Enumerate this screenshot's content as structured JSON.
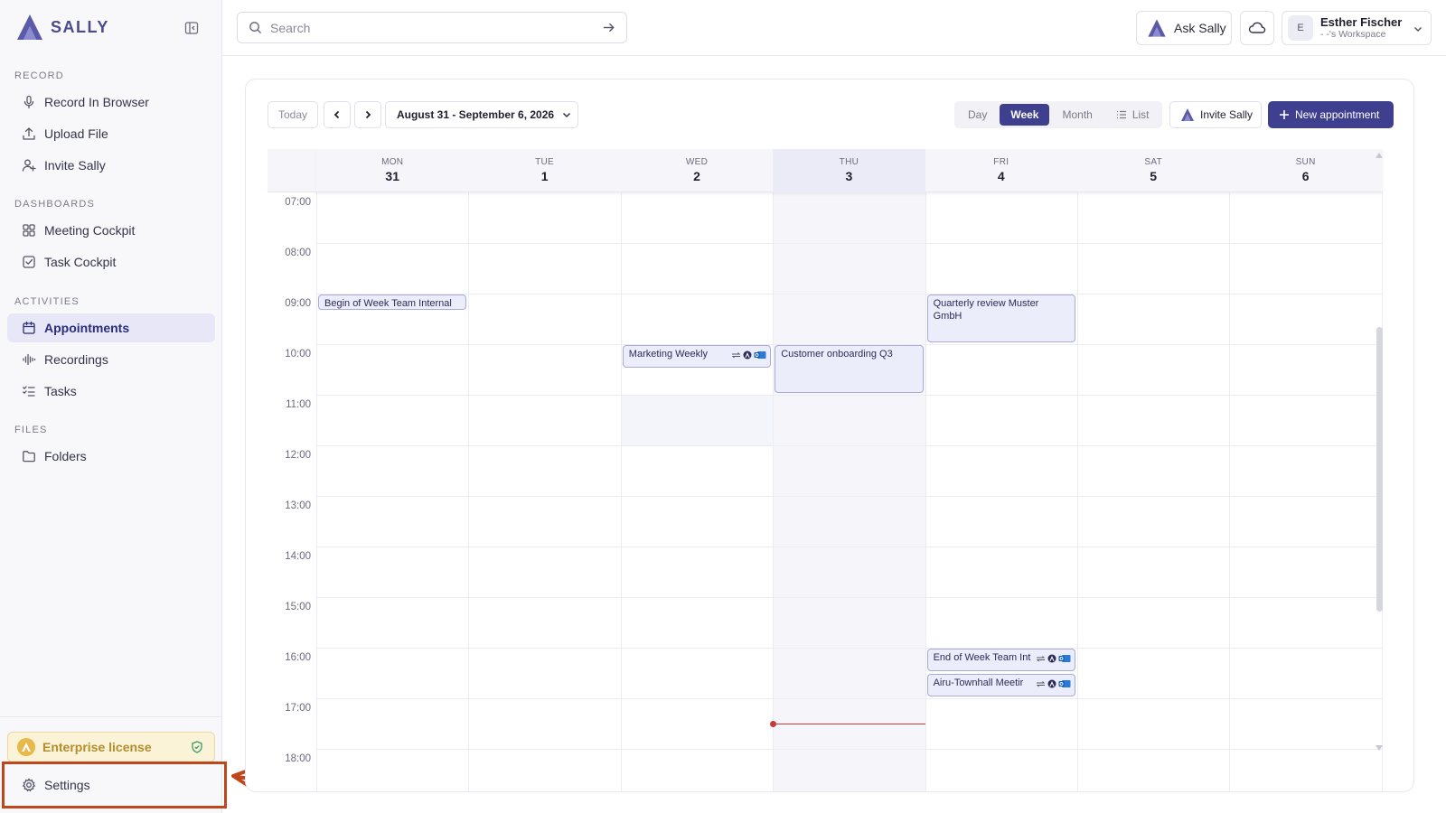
{
  "app": {
    "logo_text": "SALLY",
    "brand_color": "#4a4a8c"
  },
  "sidebar": {
    "sections": [
      {
        "label": "RECORD",
        "items": [
          {
            "label": "Record In Browser",
            "icon": "microphone-icon"
          },
          {
            "label": "Upload File",
            "icon": "upload-icon"
          },
          {
            "label": "Invite Sally",
            "icon": "user-plus-icon"
          }
        ]
      },
      {
        "label": "DASHBOARDS",
        "items": [
          {
            "label": "Meeting Cockpit",
            "icon": "grid-icon"
          },
          {
            "label": "Task Cockpit",
            "icon": "checkbox-icon"
          }
        ]
      },
      {
        "label": "ACTIVITIES",
        "items": [
          {
            "label": "Appointments",
            "icon": "calendar-icon",
            "active": true
          },
          {
            "label": "Recordings",
            "icon": "waveform-icon"
          },
          {
            "label": "Tasks",
            "icon": "task-list-icon"
          }
        ]
      },
      {
        "label": "FILES",
        "items": [
          {
            "label": "Folders",
            "icon": "folder-icon"
          }
        ]
      }
    ],
    "license_label": "Enterprise license",
    "settings_label": "Settings"
  },
  "header": {
    "search_placeholder": "Search",
    "ask_label": "Ask Sally",
    "user_name": "Esther Fischer",
    "user_workspace": "- -'s Workspace",
    "avatar_initial": "E"
  },
  "toolbar": {
    "today_label": "Today",
    "range_label": "August 31 - September 6, 2026",
    "views": [
      "Day",
      "Week",
      "Month",
      "List"
    ],
    "active_view": "Week",
    "invite_label": "Invite Sally",
    "new_label": "New appointment",
    "accent_color": "#3f3f90"
  },
  "calendar": {
    "days": [
      {
        "dow": "MON",
        "num": "31"
      },
      {
        "dow": "TUE",
        "num": "1"
      },
      {
        "dow": "WED",
        "num": "2"
      },
      {
        "dow": "THU",
        "num": "3",
        "today": true
      },
      {
        "dow": "FRI",
        "num": "4"
      },
      {
        "dow": "SAT",
        "num": "5"
      },
      {
        "dow": "SUN",
        "num": "6"
      }
    ],
    "hours": [
      "07:00",
      "08:00",
      "09:00",
      "10:00",
      "11:00",
      "12:00",
      "13:00",
      "14:00",
      "15:00",
      "16:00",
      "17:00",
      "18:00"
    ],
    "events": [
      {
        "title": "Begin of Week Team Internal",
        "day": 0,
        "start": 9.0,
        "end": 9.35
      },
      {
        "title": "Marketing Weekly",
        "day": 2,
        "start": 10.0,
        "end": 10.5,
        "icons": true
      },
      {
        "title": "Customer onboarding Q3",
        "day": 3,
        "start": 10.0,
        "end": 11.0
      },
      {
        "title": "Quarterly review Muster GmbH",
        "day": 4,
        "start": 9.0,
        "end": 10.0
      },
      {
        "title": "End of Week Team Int",
        "day": 4,
        "start": 16.0,
        "end": 16.5,
        "icons": true
      },
      {
        "title": "Airu-Townhall Meetir",
        "day": 4,
        "start": 16.5,
        "end": 17.0,
        "icons": true
      }
    ],
    "now_time": 17.5,
    "now_color": "#c73a3a"
  }
}
